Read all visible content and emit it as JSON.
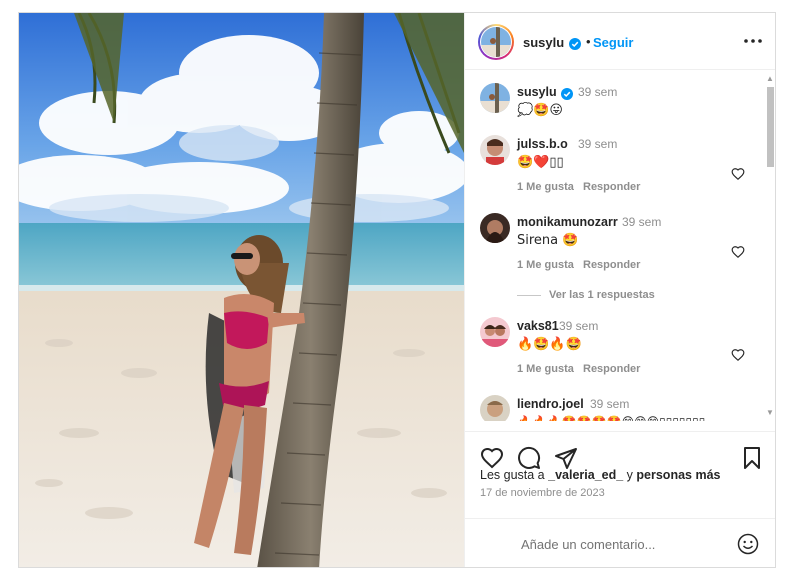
{
  "post": {
    "username": "susylu",
    "separator": "•",
    "follow_label": "Seguir",
    "more_icon": "more-horizontal-icon"
  },
  "caption": {
    "username": "susylu",
    "time": "39 sem",
    "text": "💭🤩😛"
  },
  "comments": [
    {
      "username": "julss.b.o",
      "time": "39 sem",
      "text": "🤩❤️▯▯",
      "likes_label": "1 Me gusta",
      "reply_label": "Responder"
    },
    {
      "username": "monikamunozarr",
      "time": "39 sem",
      "text": "Sirena 🤩",
      "likes_label": "1 Me gusta",
      "reply_label": "Responder",
      "replies_label": "Ver las 1 respuestas"
    },
    {
      "username": "vaks81",
      "time": "39 sem",
      "text": "🔥🤩🔥🤩",
      "likes_label": "1 Me gusta",
      "reply_label": "Responder"
    },
    {
      "username": "liendro.joel",
      "time": "39 sem",
      "text": "🔥🔥🔥🤩🤩🤩🤩😊😊😊▯▯▯▯▯▯▯"
    }
  ],
  "likes": {
    "prefix": "Les gusta a",
    "user": "_valeria_ed_",
    "middle": "y",
    "suffix": "personas más"
  },
  "date": "17 de noviembre de 2023",
  "add_comment": {
    "placeholder": "Añade un comentario..."
  },
  "colors": {
    "accent": "#0095f6",
    "verified": "#0095f6",
    "heart": "#e0245e"
  }
}
